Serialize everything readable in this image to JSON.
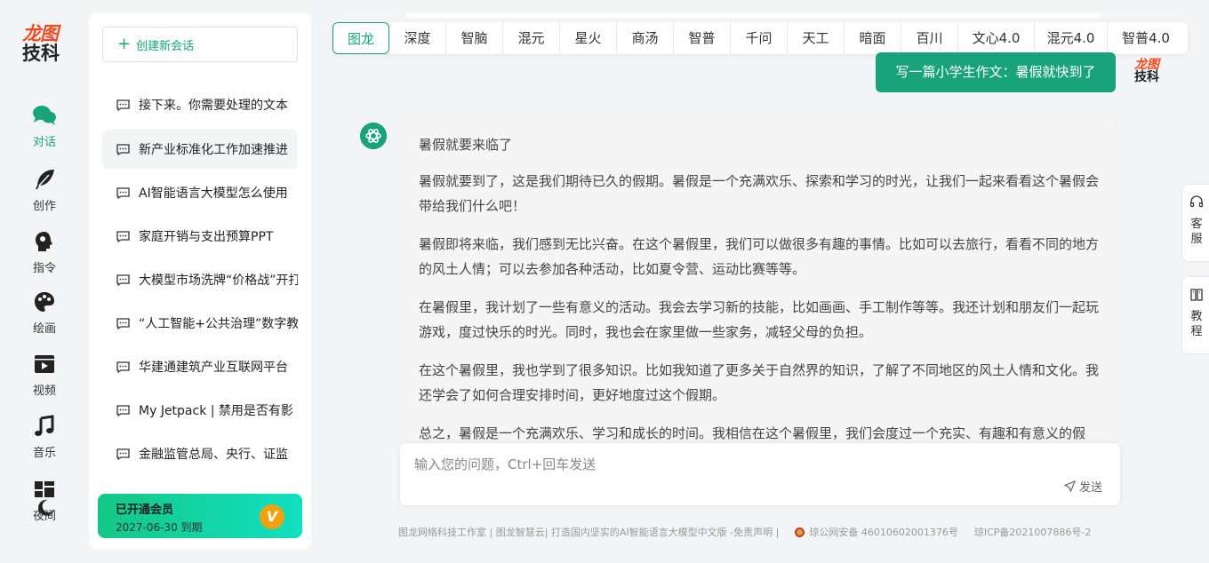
{
  "brand": {
    "line1": "龙图",
    "line2": "技科",
    "primary": "#19a37b",
    "logo_red": "#ef4b22"
  },
  "rail": {
    "items": [
      {
        "label": "对话",
        "icon": "chat-bubbles-icon",
        "active": true
      },
      {
        "label": "创作",
        "icon": "feather-icon"
      },
      {
        "label": "指令",
        "icon": "head-icon"
      },
      {
        "label": "绘画",
        "icon": "palette-icon"
      },
      {
        "label": "视频",
        "icon": "video-play-icon"
      },
      {
        "label": "音乐",
        "icon": "music-note-icon"
      },
      {
        "label": "夜间",
        "icon": "grid-moon-icon"
      }
    ]
  },
  "sidebar": {
    "new_chat_label": "创建新会话",
    "conversations": [
      "接下来。你需要处理的文本",
      "新产业标准化工作加速推进",
      "AI智能语言大模型怎么使用",
      "家庭开销与支出预算PPT",
      "大模型市场洗牌“价格战”开打",
      "“人工智能+公共治理”数字教",
      "华建通建筑产业互联网平台",
      "My Jetpack | 禁用是否有影",
      "金融监管总局、央行、证监"
    ],
    "member": {
      "status": "已开通会员",
      "expiry": "2027-06-30 到期",
      "badge": "V"
    }
  },
  "models": {
    "tabs": [
      "图龙",
      "深度",
      "智脑",
      "混元",
      "星火",
      "商汤",
      "智普",
      "千问",
      "天工",
      "暗面",
      "百川",
      "文心4.0",
      "混元4.0",
      "智普4.0"
    ],
    "active": "图龙"
  },
  "chat": {
    "user_message": "写一篇小学生作文：暑假就快到了",
    "answer_paragraphs": [
      "暑假就要来临了",
      "暑假就要到了，这是我们期待已久的假期。暑假是一个充满欢乐、探索和学习的时光，让我们一起来看看这个暑假会带给我们什么吧！",
      "暑假即将来临，我们感到无比兴奋。在这个暑假里，我们可以做很多有趣的事情。比如可以去旅行，看看不同的地方的风土人情；可以去参加各种活动，比如夏令营、运动比赛等等。",
      "在暑假里，我计划了一些有意义的活动。我会去学习新的技能，比如画画、手工制作等等。我还计划和朋友们一起玩游戏，度过快乐的时光。同时，我也会在家里做一些家务，减轻父母的负担。",
      "在这个暑假里，我也学到了很多知识。比如我知道了更多关于自然界的知识，了解了不同地区的风土人情和文化。我还学会了如何合理安排时间，更好地度过这个假期。",
      "总之，暑假是一个充满欢乐、学习和成长的时间。我相信在这个暑假里，我们会度过一个充实、有趣和有意义的假期。"
    ]
  },
  "input": {
    "placeholder": "输入您的问题，Ctrl+回车发送",
    "value": "",
    "send_label": "发送"
  },
  "float_tools": [
    {
      "label": "客服",
      "icon": "headset-icon"
    },
    {
      "label": "教程",
      "icon": "book-icon"
    }
  ],
  "footer": {
    "left": "图龙网络科技工作室 | 图龙智慧云| 打造国内坚实的AI智能语言大模型中文版 -免责声明 |",
    "police": "琼公网安备 46010602001376号",
    "icp": "琼ICP备2021007886号-2"
  }
}
